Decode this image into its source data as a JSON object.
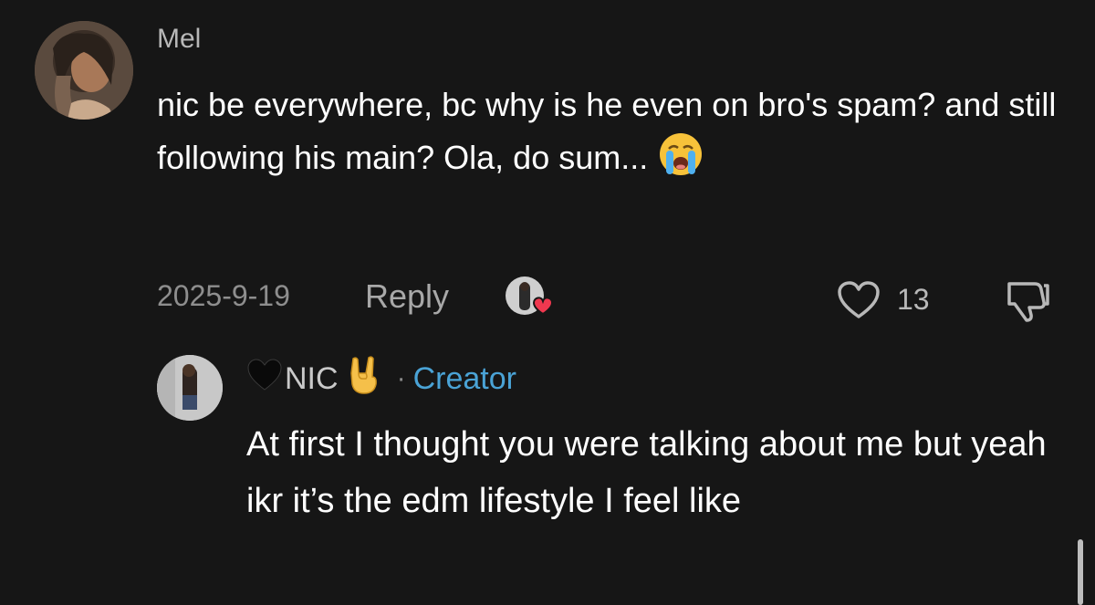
{
  "comment": {
    "username": "Mel",
    "text": "nic be everywhere, bc why is he even on bro's spam? and still following his main? Ola, do sum...",
    "emoji": "loudly-crying-face",
    "date": "2025-9-19",
    "reply_label": "Reply",
    "like_count": "13"
  },
  "reply": {
    "username": "NIC",
    "creator_separator": "·",
    "creator_label": "Creator",
    "text": "At first I thought you were talking about me but yeah ikr it’s the edm lifestyle I feel like"
  },
  "colors": {
    "background": "#161616",
    "creator": "#4aa3d6",
    "heart_badge": "#f0384f"
  }
}
